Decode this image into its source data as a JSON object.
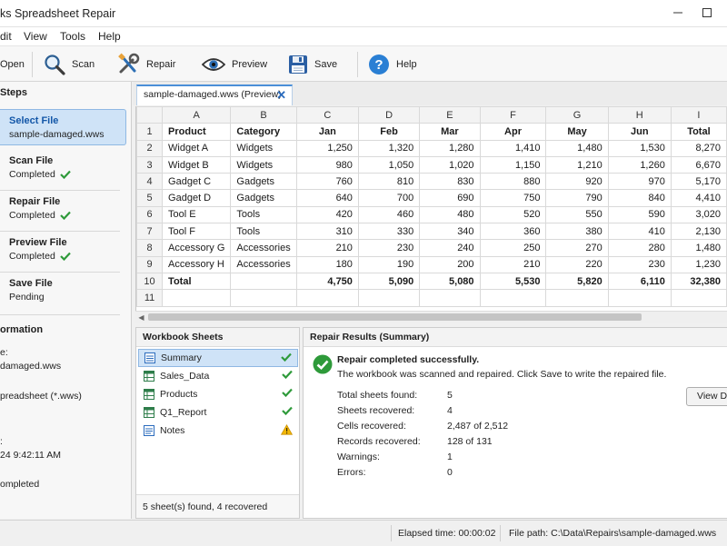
{
  "window": {
    "title": "ks Spreadsheet Repair",
    "controls": [
      "minimize",
      "maximize",
      "close"
    ]
  },
  "menu": [
    "dit",
    "View",
    "Tools",
    "Help"
  ],
  "toolbar": {
    "open": "Open",
    "scan": "Scan",
    "repair": "Repair",
    "preview": "Preview",
    "save": "Save",
    "help": "Help"
  },
  "steps": {
    "heading": "Steps",
    "items": [
      {
        "title": "Select File",
        "sub": "sample-damaged.wws",
        "check": false
      },
      {
        "title": "Scan File",
        "sub": "Completed",
        "check": true
      },
      {
        "title": "Repair File",
        "sub": "Completed",
        "check": true
      },
      {
        "title": "Preview File",
        "sub": "Completed",
        "check": true
      },
      {
        "title": "Save File",
        "sub": "Pending",
        "check": false
      }
    ]
  },
  "information": {
    "heading": "ormation",
    "lines": [
      "e:",
      "damaged.wws",
      "preadsheet (*.wws)",
      ":",
      "24  9:42:11 AM",
      "ompleted"
    ]
  },
  "doc_tab": {
    "label": "sample-damaged.wws (Preview)",
    "close": "✕"
  },
  "sheet": {
    "columns": [
      "A",
      "B",
      "C",
      "D",
      "E",
      "F",
      "G",
      "H",
      "I"
    ],
    "row_numbers": [
      "1",
      "2",
      "3",
      "4",
      "5",
      "6",
      "7",
      "8",
      "9",
      "10",
      "11"
    ],
    "header": [
      "Product",
      "Category",
      "Jan",
      "Feb",
      "Mar",
      "Apr",
      "May",
      "Jun",
      "Total"
    ],
    "rows": [
      [
        "Widget A",
        "Widgets",
        "1,250",
        "1,320",
        "1,280",
        "1,410",
        "1,480",
        "1,530",
        "8,270"
      ],
      [
        "Widget B",
        "Widgets",
        "980",
        "1,050",
        "1,020",
        "1,150",
        "1,210",
        "1,260",
        "6,670"
      ],
      [
        "Gadget C",
        "Gadgets",
        "760",
        "810",
        "830",
        "880",
        "920",
        "970",
        "5,170"
      ],
      [
        "Gadget D",
        "Gadgets",
        "640",
        "700",
        "690",
        "750",
        "790",
        "840",
        "4,410"
      ],
      [
        "Tool E",
        "Tools",
        "420",
        "460",
        "480",
        "520",
        "550",
        "590",
        "3,020"
      ],
      [
        "Tool F",
        "Tools",
        "310",
        "330",
        "340",
        "360",
        "380",
        "410",
        "2,130"
      ],
      [
        "Accessory G",
        "Accessories",
        "210",
        "230",
        "240",
        "250",
        "270",
        "280",
        "1,480"
      ],
      [
        "Accessory H",
        "Accessories",
        "180",
        "190",
        "200",
        "210",
        "220",
        "230",
        "1,230"
      ]
    ],
    "total": [
      "Total",
      "",
      "4,750",
      "5,090",
      "5,080",
      "5,530",
      "5,820",
      "6,110",
      "32,380"
    ]
  },
  "workbook_sheets": {
    "heading": "Workbook Sheets",
    "items": [
      {
        "name": "Summary",
        "status": "ok"
      },
      {
        "name": "Sales_Data",
        "status": "ok"
      },
      {
        "name": "Products",
        "status": "ok"
      },
      {
        "name": "Q1_Report",
        "status": "ok"
      },
      {
        "name": "Notes",
        "status": "warning"
      }
    ],
    "footer": "5 sheet(s) found, 4 recovered"
  },
  "repair_results": {
    "heading": "Repair Results (Summary)",
    "title": "Repair completed successfully.",
    "subtitle": "The workbook was scanned and repaired. Click Save to write the repaired file.",
    "stats": [
      {
        "label": "Total sheets found:",
        "value": "5"
      },
      {
        "label": "Sheets recovered:",
        "value": "4"
      },
      {
        "label": "Cells recovered:",
        "value": "2,487 of 2,512"
      },
      {
        "label": "Records recovered:",
        "value": "128 of 131"
      },
      {
        "label": "Warnings:",
        "value": "1"
      },
      {
        "label": "Errors:",
        "value": "0"
      }
    ],
    "view_button": "View De"
  },
  "statusbar": {
    "elapsed": "Elapsed time: 00:00:02",
    "filepath": "File path: C:\\Data\\Repairs\\sample-damaged.wws"
  },
  "colors": {
    "accent": "#1357a8",
    "selection": "#cfe3f7",
    "success": "#2e9a3a",
    "warning": "#f2b705",
    "help": "#2a7fd4"
  }
}
